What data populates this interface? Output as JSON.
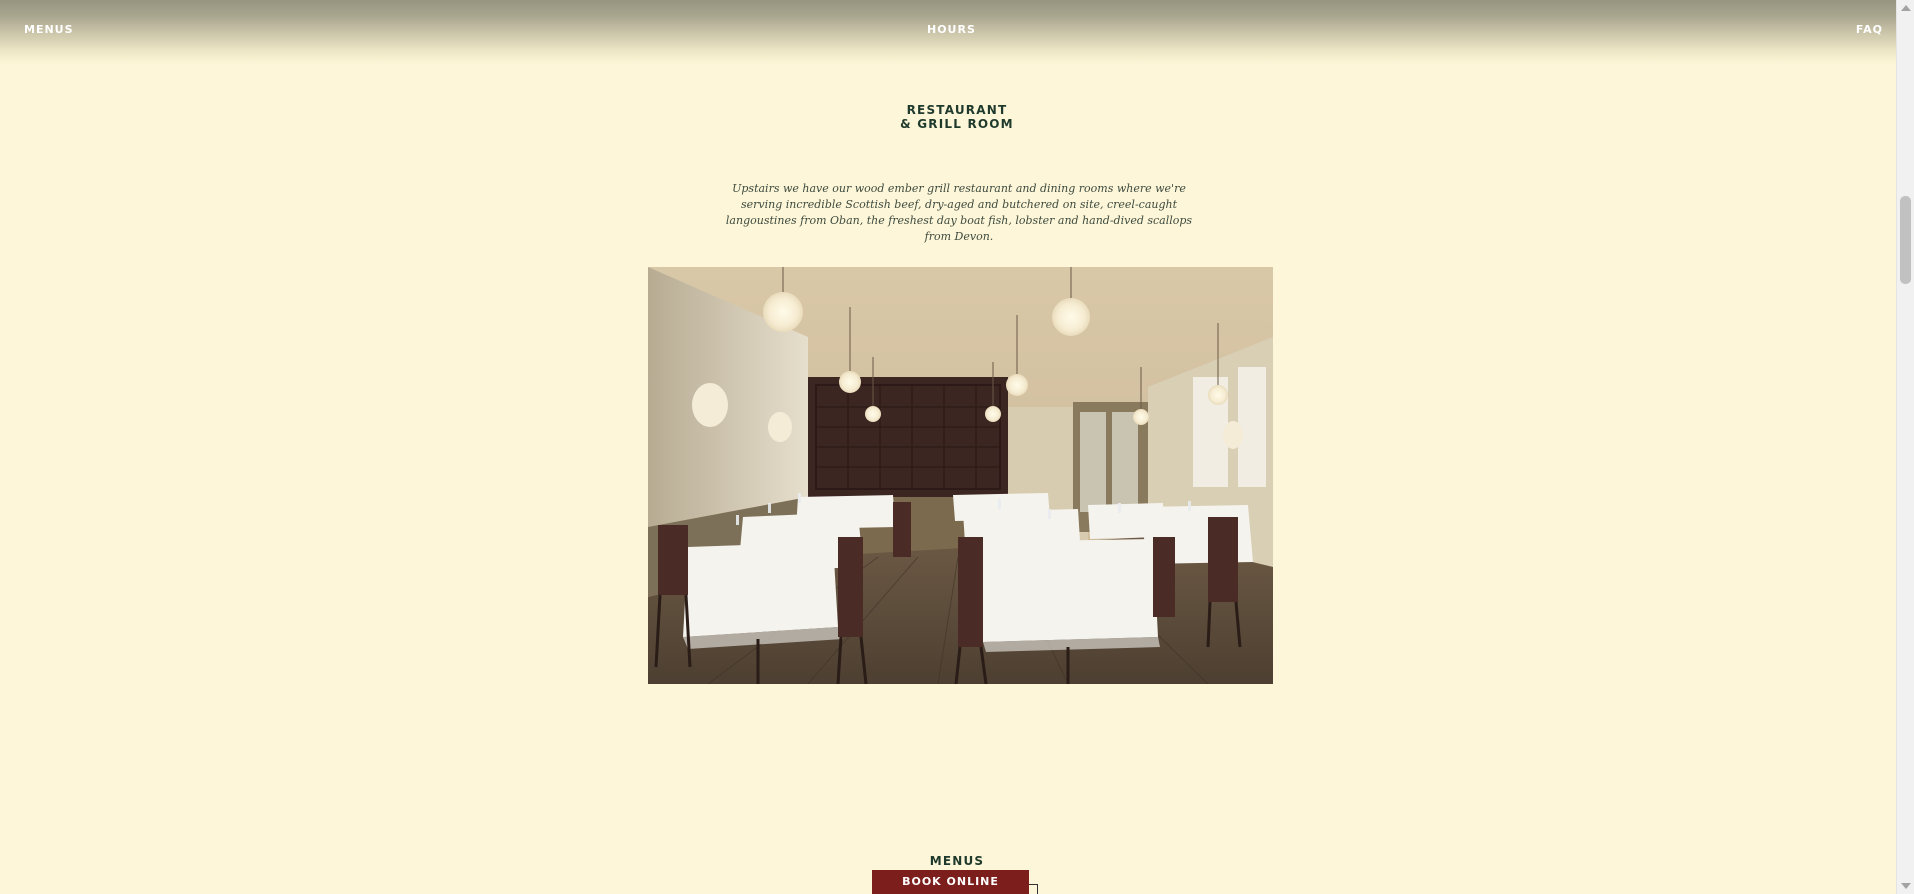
{
  "nav": {
    "menus_label": "MENUS",
    "hours_label": "HOURS",
    "faq_label": "FAQ"
  },
  "section": {
    "title_line1": "RESTAURANT",
    "title_line2": "& GRILL ROOM",
    "description": "Upstairs we have our wood ember grill restaurant and dining rooms where we're serving incredible Scottish beef, dry-aged and butchered on site, creel-caught langoustines from Oban, the freshest day boat fish, lobster and hand-dived scallops from Devon."
  },
  "menus_heading": "MENUS",
  "book_button_label": "BOOK ONLINE",
  "colors": {
    "background": "#fdf6d8",
    "heading": "#1f3a2c",
    "button": "#7c1f1c"
  }
}
